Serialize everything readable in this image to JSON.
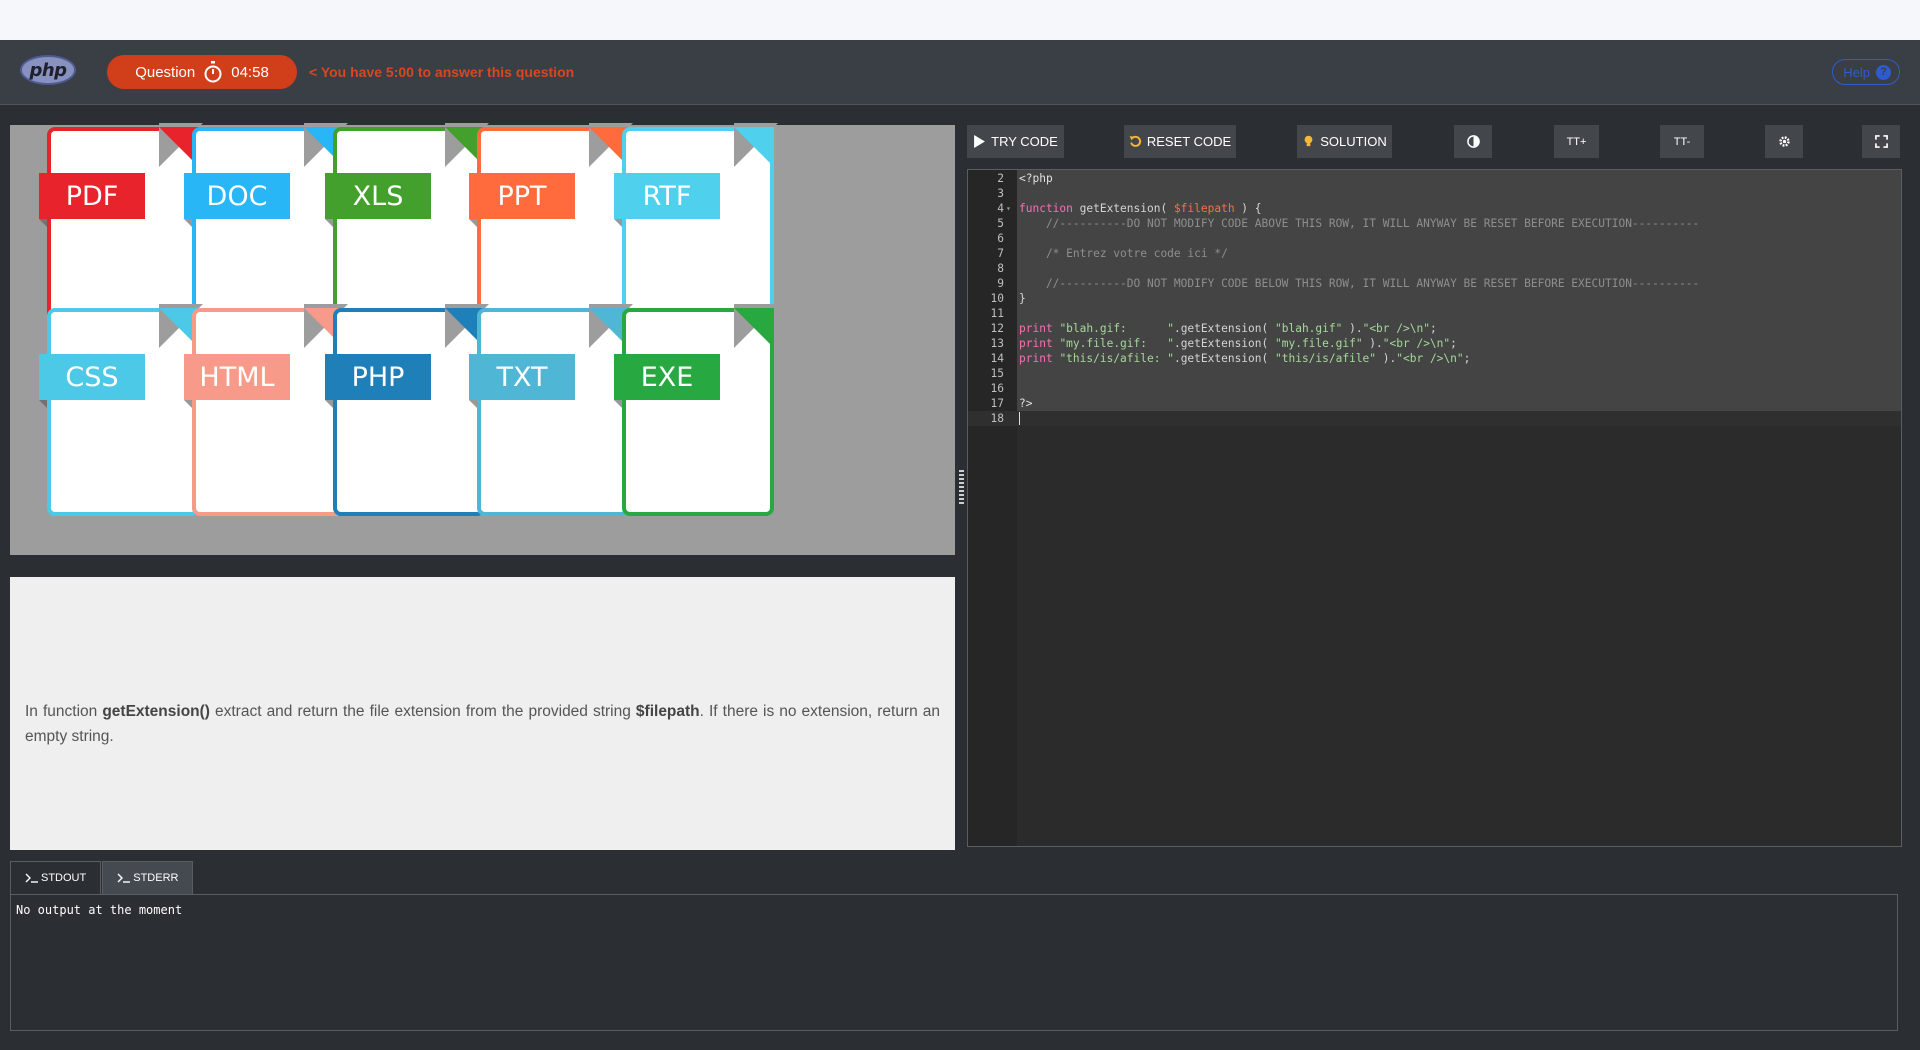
{
  "navbar": {
    "logo_text": "php",
    "timer_label": "Question",
    "timer_value": "04:58",
    "timer_message": "< You have 5:00 to answer this question",
    "help_label": "Help",
    "help_icon": "question-circle-icon",
    "accent_color": "#d03e1a"
  },
  "image": {
    "files": [
      {
        "label": "PDF",
        "color": "#e8232b",
        "tag_color": "#e8232b"
      },
      {
        "label": "DOC",
        "color": "#29b6f6",
        "tag_color": "#29b6f6"
      },
      {
        "label": "XLS",
        "color": "#43a02c",
        "tag_color": "#43a02c"
      },
      {
        "label": "PPT",
        "color": "#ff6b3c",
        "tag_color": "#ff6b3c"
      },
      {
        "label": "RTF",
        "color": "#4fd0ec",
        "tag_color": "#4fd0ec"
      },
      {
        "label": "CSS",
        "color": "#4dc9e8",
        "tag_color": "#4dc9e8"
      },
      {
        "label": "HTML",
        "color": "#f89a8a",
        "tag_color": "#f89a8a"
      },
      {
        "label": "PHP",
        "color": "#1e7fb9",
        "tag_color": "#1e7fb9"
      },
      {
        "label": "TXT",
        "color": "#4fb6d6",
        "tag_color": "#4fb6d6"
      },
      {
        "label": "EXE",
        "color": "#27a841",
        "tag_color": "#27a841"
      }
    ]
  },
  "question": {
    "text_1": "In function ",
    "fn_name": "getExtension()",
    "text_2": " extract and return the file extension from the provided string ",
    "param_name": "$filepath",
    "text_3": ". If there is no extension, return an empty string."
  },
  "toolbar": {
    "try_code": "TRY CODE",
    "reset_code": "RESET CODE",
    "solution": "SOLUTION",
    "theme_icon": "contrast-icon",
    "font_up_label": "TT+",
    "font_down_label": "TT-",
    "settings_icon": "gear-icon",
    "fullscreen_icon": "fullscreen-icon"
  },
  "editor": {
    "lines": [
      {
        "n": "2",
        "t": "<?php"
      },
      {
        "n": "3",
        "t": ""
      },
      {
        "n": "4",
        "t": "function getExtension( $filepath ) {",
        "fold": true
      },
      {
        "n": "5",
        "t": "    //----------DO NOT MODIFY CODE ABOVE THIS ROW, IT WILL ANYWAY BE RESET BEFORE EXECUTION----------"
      },
      {
        "n": "6",
        "t": ""
      },
      {
        "n": "7",
        "t": "    /* Entrez votre code ici */"
      },
      {
        "n": "8",
        "t": ""
      },
      {
        "n": "9",
        "t": "    //----------DO NOT MODIFY CODE BELOW THIS ROW, IT WILL ANYWAY BE RESET BEFORE EXECUTION----------"
      },
      {
        "n": "10",
        "t": "}"
      },
      {
        "n": "11",
        "t": ""
      },
      {
        "n": "12",
        "t": "print \"blah.gif:      \".getExtension( \"blah.gif\" ).\"<br />\\n\";"
      },
      {
        "n": "13",
        "t": "print \"my.file.gif:   \".getExtension( \"my.file.gif\" ).\"<br />\\n\";"
      },
      {
        "n": "14",
        "t": "print \"this/is/afile: \".getExtension( \"this/is/afile\" ).\"<br />\\n\";"
      },
      {
        "n": "15",
        "t": ""
      },
      {
        "n": "16",
        "t": ""
      },
      {
        "n": "17",
        "t": "?>"
      },
      {
        "n": "18",
        "t": ""
      }
    ]
  },
  "output": {
    "tab_stdout": "STDOUT",
    "tab_stderr": "STDERR",
    "tab_icon": "terminal-icon",
    "text": "No output at the moment"
  }
}
